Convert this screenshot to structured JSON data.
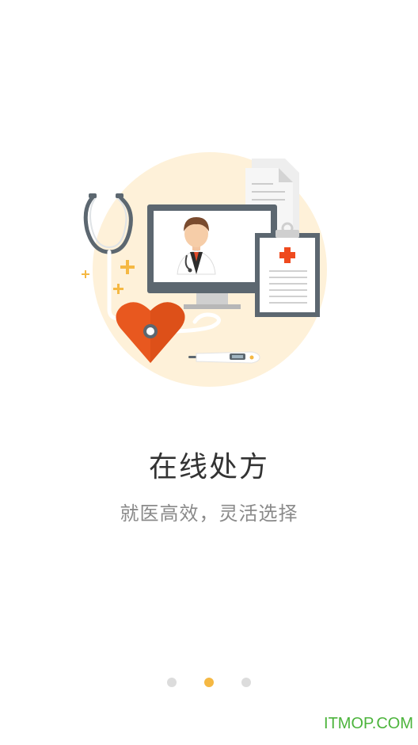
{
  "onboarding": {
    "title": "在线处方",
    "subtitle": "就医高效，灵活选择",
    "total_pages": 3,
    "current_page": 2
  },
  "watermark": "ITMOP.COM",
  "colors": {
    "accent": "#f5b843",
    "heart": "#e8581f",
    "circle_bg": "#fef1d9",
    "medical_cross": "#ef4a1e",
    "frame_gray": "#5c6770"
  },
  "icons": [
    "stethoscope-icon",
    "monitor-icon",
    "doctor-avatar-icon",
    "clipboard-icon",
    "heart-icon",
    "thermometer-icon",
    "plus-sparkle-icon"
  ]
}
